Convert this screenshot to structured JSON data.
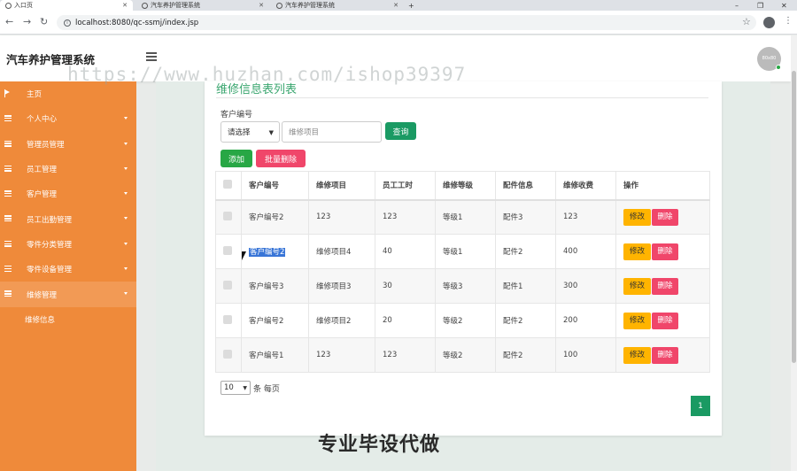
{
  "browser": {
    "tabs": [
      {
        "label": "入口页"
      },
      {
        "label": "汽车养护管理系统"
      },
      {
        "label": "汽车养护管理系统"
      }
    ],
    "url": "localhost:8080/qc-ssmj/index.jsp"
  },
  "header": {
    "title": "汽车养护管理系统",
    "avatar_text": "80x80"
  },
  "watermark": "https://www.huzhan.com/ishop39397",
  "sidebar": {
    "items": [
      {
        "label": "主页"
      },
      {
        "label": "个人中心"
      },
      {
        "label": "管理员管理"
      },
      {
        "label": "员工管理"
      },
      {
        "label": "客户管理"
      },
      {
        "label": "员工出勤管理"
      },
      {
        "label": "零件分类管理"
      },
      {
        "label": "零件设备管理"
      },
      {
        "label": "维修管理"
      }
    ],
    "subitem": "维修信息"
  },
  "panel": {
    "title": "维修信息表列表",
    "filter_label": "客户编号",
    "select_value": "请选择",
    "input_placeholder": "维修项目",
    "search_label": "查询",
    "add_label": "添加",
    "batch_delete_label": "批量删除"
  },
  "table": {
    "headers": [
      "客户编号",
      "维修项目",
      "员工工时",
      "维修等级",
      "配件信息",
      "维修收费",
      "操作"
    ],
    "rows": [
      [
        "客户编号2",
        "123",
        "123",
        "等级1",
        "配件3",
        "123"
      ],
      [
        "客户编号2",
        "维修项目4",
        "40",
        "等级1",
        "配件2",
        "400"
      ],
      [
        "客户编号3",
        "维修项目3",
        "30",
        "等级3",
        "配件1",
        "300"
      ],
      [
        "客户编号2",
        "维修项目2",
        "20",
        "等级2",
        "配件2",
        "200"
      ],
      [
        "客户编号1",
        "123",
        "123",
        "等级2",
        "配件2",
        "100"
      ]
    ],
    "edit_label": "修改",
    "delete_label": "删除"
  },
  "pagination": {
    "page_size": "10",
    "page_size_suffix": "条 每页",
    "current_page": "1"
  },
  "overlay_text": "专业毕设代做"
}
